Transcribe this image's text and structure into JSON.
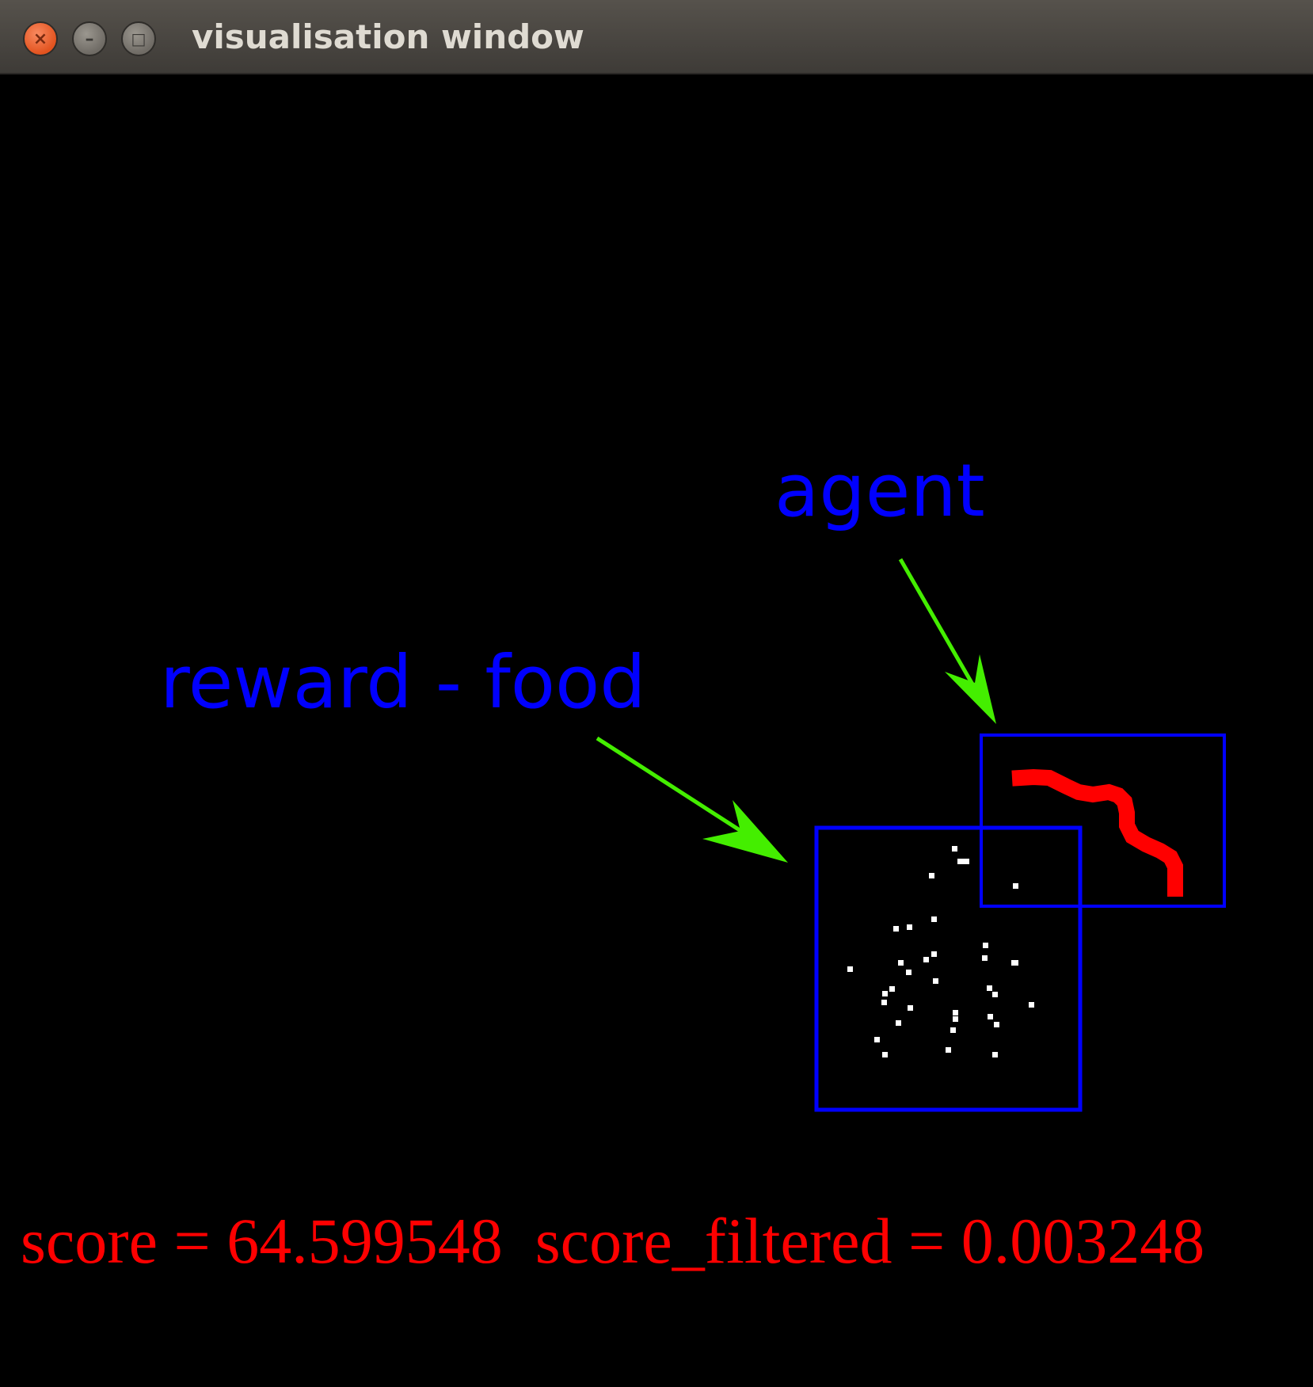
{
  "window": {
    "title": "visualisation window",
    "controls": {
      "close_glyph": "×",
      "minimize_glyph": "–",
      "maximize_glyph": "□"
    }
  },
  "annotations": {
    "agent_label": "agent",
    "food_label": "reward - food",
    "label_color": "#0000ff",
    "arrow_color": "#44ee00",
    "box_color": "#0000ff"
  },
  "status": {
    "score_label": "score = 64.599548",
    "score_filtered_label": "score_filtered = 0.003248",
    "text_color": "#ff0000"
  },
  "colors": {
    "background": "#000000",
    "agent": "#ff0000",
    "food": "#ffffff"
  }
}
